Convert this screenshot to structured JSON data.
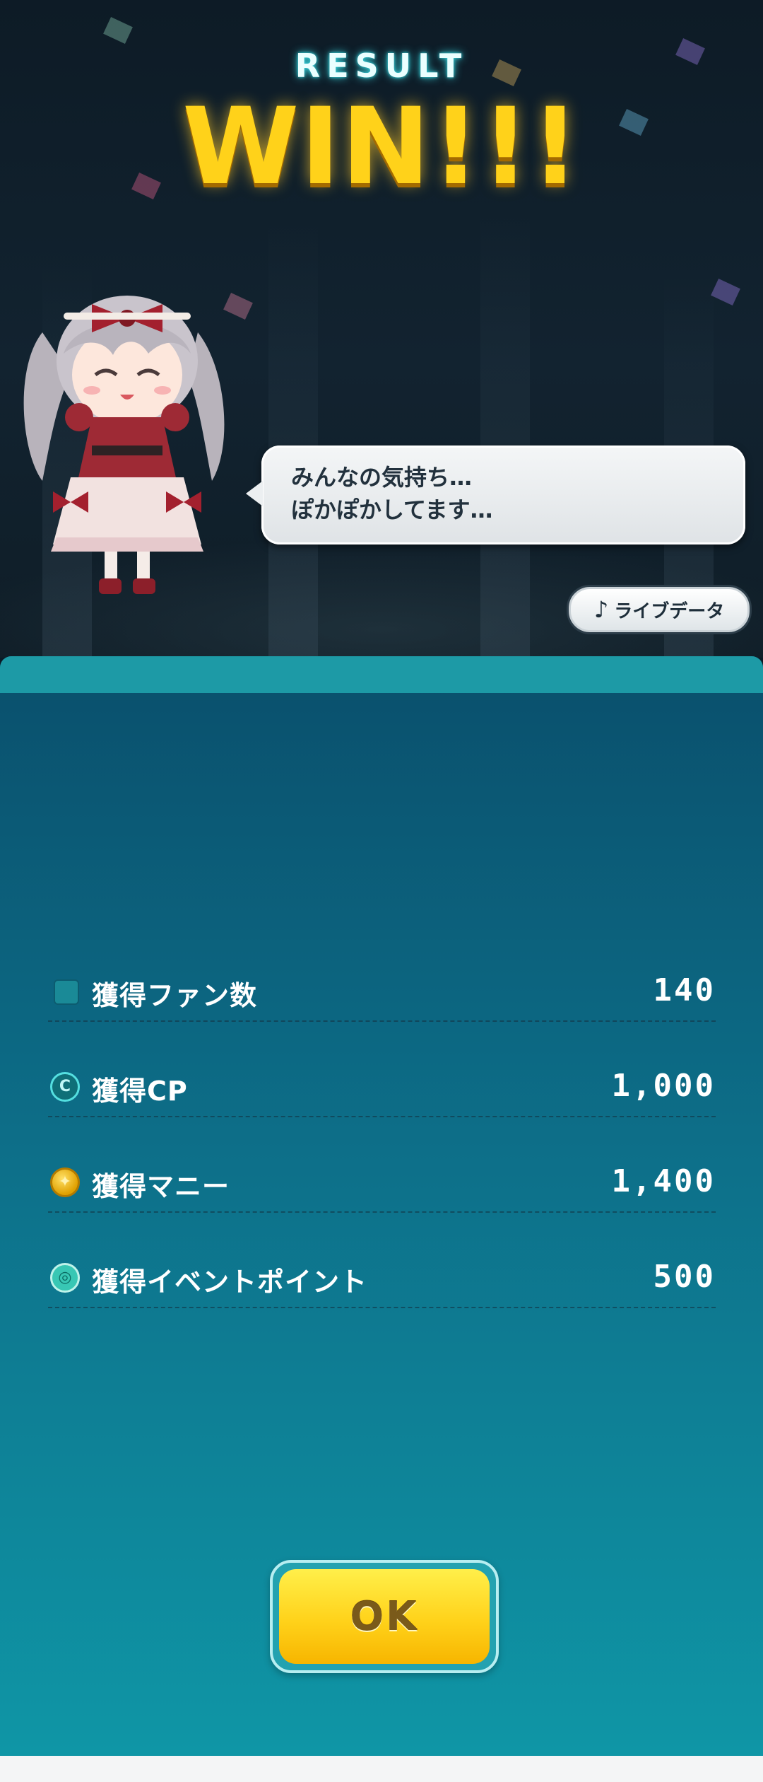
{
  "header": {
    "result_label": "RESULT",
    "win_label": "WIN!!!"
  },
  "character": {
    "speech": "みんなの気持ち…\nぽかぽかしてます…"
  },
  "live_data_button": {
    "icon": "music-note-icon",
    "label": "ライブデータ"
  },
  "rewards": [
    {
      "icon": "fan-square-icon",
      "label": "獲得ファン数",
      "value": "140"
    },
    {
      "icon": "cp-coin-icon",
      "label": "獲得CP",
      "value": "1,000"
    },
    {
      "icon": "money-coin-icon",
      "label": "獲得マニー",
      "value": "1,400"
    },
    {
      "icon": "event-point-icon",
      "label": "獲得イベントポイント",
      "value": "500"
    }
  ],
  "ok_button": {
    "label": "OK"
  },
  "colors": {
    "win_gold": "#ffd21a",
    "result_glow": "#37d7e0",
    "panel_top": "#0a4f6c",
    "panel_bottom": "#0f96a6",
    "ok_yellow": "#ffd21a"
  }
}
